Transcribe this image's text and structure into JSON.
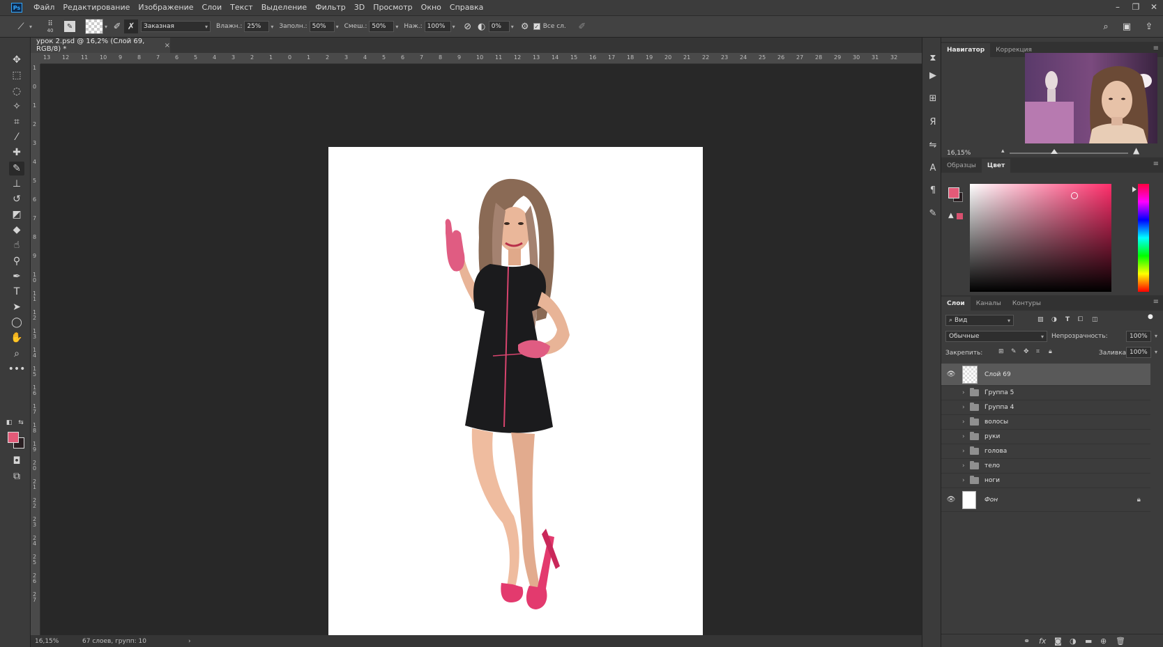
{
  "app": {
    "logo": "Ps",
    "menu": [
      "Файл",
      "Редактирование",
      "Изображение",
      "Слои",
      "Текст",
      "Выделение",
      "Фильтр",
      "3D",
      "Просмотр",
      "Окно",
      "Справка"
    ],
    "window_controls": [
      "–",
      "❐",
      "✕"
    ]
  },
  "options": {
    "brush_size": "40",
    "preset": "Заказная",
    "wet_label": "Влажн.:",
    "wet_value": "25%",
    "load_label": "Заполн.:",
    "load_value": "50%",
    "mix_label": "Смеш.:",
    "mix_value": "50%",
    "flow_label": "Наж.:",
    "flow_value": "100%",
    "smoothing_value": "0%",
    "sample_all_label": "Все сл."
  },
  "document": {
    "tab_title": "урок 2.psd @ 16,2% (Слой 69, RGB/8) *",
    "tab_close": "×",
    "ruler_h": [
      "13",
      "12",
      "11",
      "10",
      "9",
      "8",
      "7",
      "6",
      "5",
      "4",
      "3",
      "2",
      "1",
      "0",
      "1",
      "2",
      "3",
      "4",
      "5",
      "6",
      "7",
      "8",
      "9",
      "10",
      "11",
      "12",
      "13",
      "14",
      "15",
      "16",
      "17",
      "18",
      "19",
      "20",
      "21",
      "22",
      "23",
      "24",
      "25",
      "26",
      "27",
      "28",
      "29",
      "30",
      "31",
      "32"
    ],
    "ruler_v": [
      "1",
      "0",
      "1",
      "2",
      "3",
      "4",
      "5",
      "6",
      "7",
      "8",
      "9",
      "1 0",
      "1 1",
      "1 2",
      "1 3",
      "1 4",
      "1 5",
      "1 6",
      "1 7",
      "1 8",
      "1 9",
      "2 0",
      "2 1",
      "2 2",
      "2 3",
      "2 4",
      "2 5",
      "2 6",
      "2 7"
    ]
  },
  "status": {
    "zoom": "16,15%",
    "info": "67 слоев, групп: 10",
    "arrow": "›"
  },
  "navigator": {
    "tabs": [
      "Навигатор",
      "Коррекция"
    ],
    "zoom": "16,15%"
  },
  "color_panel": {
    "tabs": [
      "Образцы",
      "Цвет"
    ],
    "fg_color": "#e35a78",
    "bg_color": "#2a1f22"
  },
  "layers_panel": {
    "tabs": [
      "Слои",
      "Каналы",
      "Контуры"
    ],
    "filter_label": "Вид",
    "blend_mode": "Обычные",
    "opacity_label": "Непрозрачность:",
    "opacity_value": "100%",
    "lock_label": "Закрепить:",
    "fill_label": "Заливка:",
    "fill_value": "100%",
    "layers": [
      {
        "name": "Слой 69",
        "type": "layer",
        "visible": true,
        "selected": true
      },
      {
        "name": "Группа 5",
        "type": "group",
        "visible": false
      },
      {
        "name": "Группа 4",
        "type": "group",
        "visible": false
      },
      {
        "name": "волосы",
        "type": "group",
        "visible": false
      },
      {
        "name": "руки",
        "type": "group",
        "visible": false
      },
      {
        "name": "голова",
        "type": "group",
        "visible": false
      },
      {
        "name": "тело",
        "type": "group",
        "visible": false
      },
      {
        "name": "ноги",
        "type": "group",
        "visible": false
      },
      {
        "name": "Фон",
        "type": "background",
        "visible": true,
        "locked": true
      }
    ]
  }
}
